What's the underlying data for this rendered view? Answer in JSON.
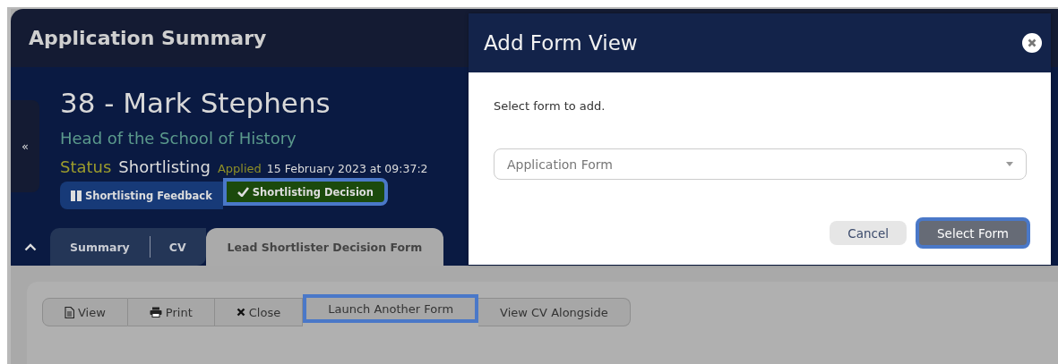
{
  "page": {
    "title": "Application Summary"
  },
  "sidebar_toggle": {
    "label": "«"
  },
  "applicant": {
    "name": "38 - Mark Stephens",
    "job_title": "Head of the School of History",
    "status_label": "Status",
    "status": "Shortlisting",
    "applied_label": "Applied",
    "applied_date": "15 February 2023 at 09:37:2"
  },
  "stage_buttons": [
    {
      "label": "Shortlisting Feedback",
      "kind": "feedback",
      "highlighted": false
    },
    {
      "label": "Shortlisting Decision",
      "kind": "decision",
      "highlighted": true
    }
  ],
  "tabs": [
    {
      "label": "Summary",
      "selected": false
    },
    {
      "label": "CV",
      "selected": false
    },
    {
      "label": "Lead Shortlister Decision Form",
      "selected": true
    }
  ],
  "toolbar": [
    {
      "label": "View",
      "kind": "view",
      "highlighted": false
    },
    {
      "label": "Print",
      "kind": "print",
      "highlighted": false
    },
    {
      "label": "Close",
      "kind": "close",
      "highlighted": false
    },
    {
      "label": "Launch Another Form",
      "kind": "plain",
      "highlighted": true
    },
    {
      "label": "View CV Alongside",
      "kind": "plain",
      "highlighted": false
    }
  ],
  "modal": {
    "title": "Add Form View",
    "prompt": "Select form to add.",
    "select": {
      "value": "Application Form"
    },
    "buttons": [
      {
        "label": "Cancel",
        "kind": "secondary",
        "highlighted": false
      },
      {
        "label": "Select Form",
        "kind": "primary",
        "highlighted": true
      }
    ]
  }
}
